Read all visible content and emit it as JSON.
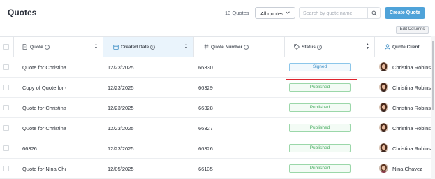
{
  "header": {
    "title": "Quotes",
    "count": "13 Quotes",
    "filter_selected": "All quotes",
    "search_placeholder": "Search by quote name",
    "create_button": "Create Quote",
    "edit_columns_button": "Edit Columns"
  },
  "columns": [
    {
      "label": "Quote",
      "icon": "document-icon"
    },
    {
      "label": "Created Date",
      "icon": "calendar-icon"
    },
    {
      "label": "Quote Number",
      "icon": "hash-icon"
    },
    {
      "label": "Status",
      "icon": "tag-icon"
    },
    {
      "label": "Quote Client",
      "icon": "user-icon"
    }
  ],
  "rows": [
    {
      "quote": "Quote for Christina",
      "date": "12/23/2025",
      "number": "66330",
      "status": "Signed",
      "client": "Christina Robinson"
    },
    {
      "quote": "Copy of Quote for C",
      "date": "12/23/2025",
      "number": "66329",
      "status": "Published",
      "client": "Christina Robinson"
    },
    {
      "quote": "Quote for Christina",
      "date": "12/23/2025",
      "number": "66328",
      "status": "Published",
      "client": "Christina Robinson"
    },
    {
      "quote": "Quote for Christina",
      "date": "12/23/2025",
      "number": "66327",
      "status": "Published",
      "client": "Christina Robinson"
    },
    {
      "quote": "66326",
      "date": "12/23/2025",
      "number": "66326",
      "status": "Published",
      "client": "Christina Robinson"
    },
    {
      "quote": "Quote for Nina Cha",
      "date": "12/05/2025",
      "number": "66135",
      "status": "Published",
      "client": "Nina Chavez"
    }
  ],
  "colors": {
    "accent": "#4fa3d9",
    "signed": "#3d8dc4",
    "published": "#4cae64",
    "highlight": "#e0242e"
  }
}
